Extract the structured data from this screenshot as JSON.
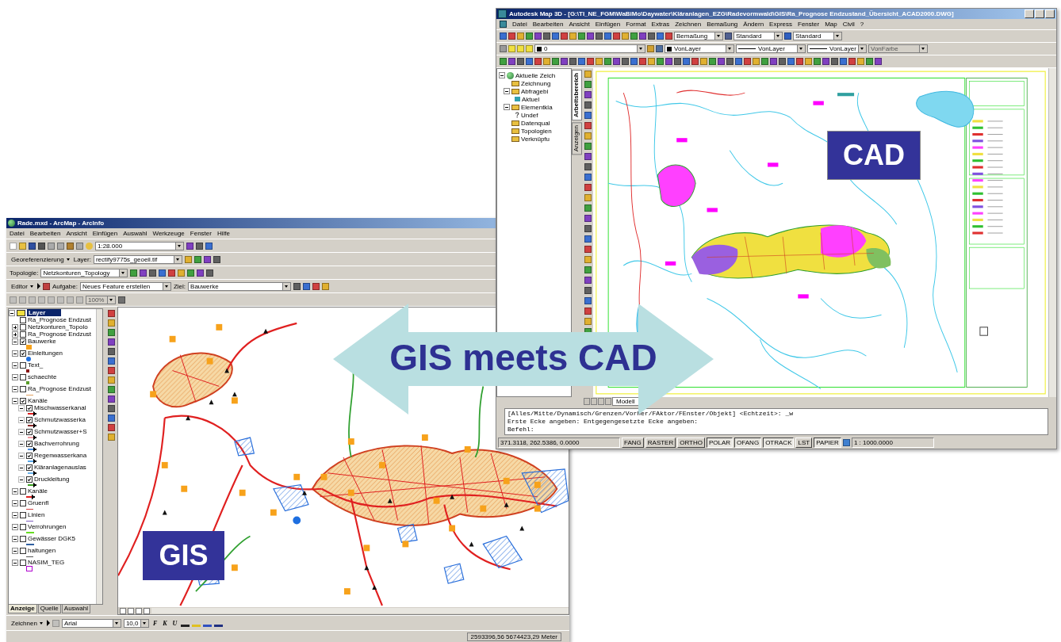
{
  "heading": "GIS meets CAD",
  "callouts": [
    {
      "text": "CAD",
      "kind": "cad"
    },
    {
      "text": "GIS",
      "kind": "gis"
    }
  ],
  "gis_window": {
    "title": "Rade.mxd - ArcMap - ArcInfo",
    "menu": [
      "Datei",
      "Bearbeiten",
      "Ansicht",
      "Einfügen",
      "Auswahl",
      "Werkzeuge",
      "Fenster",
      "Hilfe"
    ],
    "scale": "1:28.000",
    "georef_toolbar": {
      "button": "Georeferenzierung",
      "layer_label": "Layer:",
      "layer": "rectify9775s_geoeil.tif"
    },
    "topology_toolbar": {
      "label": "Topologie:",
      "topology": "Netzkonturen_Topology"
    },
    "editor_toolbar": {
      "button": "Editor",
      "task_label": "Aufgabe:",
      "task": "Neues Feature erstellen",
      "target_label": "Ziel:",
      "target": "Bauwerke"
    },
    "advanced_toolbar": {
      "zoom": "100%",
      "disabled": true
    },
    "toc": {
      "root": "Layer",
      "layers": [
        {
          "name": "Ra_Prognose Endzust",
          "checked": false,
          "expandable": false
        },
        {
          "name": "Netzkonturen_Topolo",
          "checked": false,
          "expandable": true,
          "expanded": false
        },
        {
          "name": "Ra_Prognose Endzust",
          "checked": false,
          "expandable": true,
          "expanded": false
        },
        {
          "name": "Bauwerke",
          "checked": true,
          "expandable": true,
          "expanded": true,
          "symbol": {
            "kind": "square",
            "color": "#f7a21b"
          }
        },
        {
          "name": "Einleitungen",
          "checked": true,
          "expandable": true,
          "expanded": true,
          "symbol": {
            "kind": "circle",
            "color": "#1e6fe0"
          }
        },
        {
          "name": "Text_",
          "checked": false,
          "expandable": true,
          "expanded": true,
          "symbol": {
            "kind": "dot",
            "color": "#8b1a1a"
          }
        },
        {
          "name": "schaechte",
          "checked": false,
          "expandable": true,
          "expanded": true,
          "symbol": {
            "kind": "dot",
            "color": "#5a9e2a"
          }
        },
        {
          "name": "Ra_Prognose Endzust",
          "checked": false,
          "expandable": true,
          "expanded": true,
          "symbol": {
            "kind": "line",
            "color": "#e0a060"
          }
        },
        {
          "name": "Kanäle",
          "checked": true,
          "expandable": true,
          "expanded": true,
          "children": [
            {
              "name": "Mischwasserkanal",
              "checked": true,
              "symbol": {
                "kind": "arrow",
                "color": "#e02020"
              }
            },
            {
              "name": "Schmutzwasserka",
              "checked": true,
              "symbol": {
                "kind": "arrow",
                "color": "#8b2a2a"
              }
            },
            {
              "name": "Schmutzwasser+S",
              "checked": true,
              "symbol": {
                "kind": "arrow",
                "color": "#f09aa0"
              }
            },
            {
              "name": "Bachverrohrung",
              "checked": true,
              "symbol": {
                "kind": "arrow",
                "color": "#4a90e2"
              }
            },
            {
              "name": "Regenwasserkana",
              "checked": true,
              "symbol": {
                "kind": "arrow",
                "color": "#5aa8e8"
              }
            },
            {
              "name": "Kläranlagenauslas",
              "checked": true,
              "symbol": {
                "kind": "arrow",
                "color": "#6ab4ee"
              }
            },
            {
              "name": "Druckleitung",
              "checked": true,
              "symbol": {
                "kind": "arrow",
                "color": "#3aa020"
              }
            }
          ]
        },
        {
          "name": "Kanäle",
          "checked": false,
          "expandable": true,
          "expanded": true,
          "symbol": {
            "kind": "arrow",
            "color": "#e02020"
          }
        },
        {
          "name": "Gruenfl",
          "checked": false,
          "expandable": true,
          "expanded": true,
          "symbol": {
            "kind": "line",
            "color": "#d04040"
          }
        },
        {
          "name": "Linien",
          "checked": false,
          "expandable": true,
          "expanded": true,
          "symbol": {
            "kind": "line",
            "color": "#8060c0"
          }
        },
        {
          "name": "Verrohrungen",
          "checked": false,
          "expandable": true,
          "expanded": true,
          "symbol": {
            "kind": "bar",
            "color": "#66dd22"
          }
        },
        {
          "name": "Gewässer DGK5",
          "checked": false,
          "expandable": true,
          "expanded": true,
          "symbol": {
            "kind": "bar",
            "color": "#3060a0"
          }
        },
        {
          "name": "haltungen",
          "checked": false,
          "expandable": true,
          "expanded": true,
          "symbol": {
            "kind": "line",
            "color": "#555555"
          }
        },
        {
          "name": "NASIM_TEG",
          "checked": false,
          "expandable": true,
          "expanded": true,
          "symbol": {
            "kind": "outline",
            "color": "#b000d0"
          }
        }
      ],
      "tabs": [
        {
          "label": "Anzeige",
          "selected": true
        },
        {
          "label": "Quelle",
          "selected": false
        },
        {
          "label": "Auswahl",
          "selected": false
        }
      ]
    },
    "drawing_toolbar": {
      "menu": "Zeichnen",
      "font": "Arial",
      "size": "10,0",
      "styles": [
        "F",
        "K",
        "U"
      ]
    },
    "status": "2593396,56  5674423,29 Meter"
  },
  "cad_window": {
    "title": "Autodesk Map 3D - [G:\\TI_NE_FGM\\WaBiMo\\Daywater\\Kläranlagen_EZG\\Radevormwald\\GIS\\Ra_Prognose Endzustand_Übersicht_ACAD2000.DWG]",
    "menu": [
      "Datei",
      "Bearbeiten",
      "Ansicht",
      "Einfügen",
      "Format",
      "Extras",
      "Zeichnen",
      "Bemaßung",
      "Ändern",
      "Express",
      "Fenster",
      "Map",
      "Civil",
      "?"
    ],
    "styles": {
      "dimension": "Bemaßung",
      "text": "Standard",
      "table": "Standard"
    },
    "properties": {
      "layer": "0",
      "color_setting": "VonLayer",
      "linetype": "VonLayer",
      "lineweight": "VonLayer",
      "plotstyle": "VonFarbe",
      "plotstyle_disabled": true
    },
    "panel_tabs": [
      {
        "label": "Arbeitsbereich",
        "selected": true
      },
      {
        "label": "Anzeigen",
        "selected": false
      }
    ],
    "tree": {
      "label": "Aktuelle Zeich",
      "expanded": true,
      "children": [
        {
          "label": "Zeichnung",
          "kind": "folder"
        },
        {
          "label": "Abfragebi",
          "kind": "folder",
          "expanded": true,
          "children": [
            {
              "label": "Aktuel",
              "kind": "query"
            }
          ]
        },
        {
          "label": "Elementkla",
          "kind": "folder",
          "expanded": true,
          "children": [
            {
              "label": "Undef",
              "kind": "unknown"
            }
          ]
        },
        {
          "label": "Datenqual",
          "kind": "folder"
        },
        {
          "label": "Topologien",
          "kind": "folder"
        },
        {
          "label": "Verknüpfu",
          "kind": "folder"
        }
      ]
    },
    "layout_tabs": [
      {
        "label": "Modell",
        "selected": true
      }
    ],
    "command_lines": [
      "[Alles/Mitte/Dynamisch/Grenzen/Vorher/FAktor/FEnster/Objekt] <Echtzeit>: _w",
      "Erste Ecke angeben: Entgegengesetzte Ecke angeben:",
      "Befehl:"
    ],
    "status": {
      "coords": "371.3118, 262.5386, 0.0000",
      "toggles": [
        {
          "label": "FANG",
          "on": false
        },
        {
          "label": "RASTER",
          "on": false
        },
        {
          "label": "ORTHO",
          "on": false
        },
        {
          "label": "POLAR",
          "on": true
        },
        {
          "label": "OFANG",
          "on": true
        },
        {
          "label": "OTRACK",
          "on": true
        },
        {
          "label": "LST",
          "on": false
        },
        {
          "label": "PAPIER",
          "on": true
        }
      ],
      "scale": "1 : 1000.0000"
    }
  }
}
